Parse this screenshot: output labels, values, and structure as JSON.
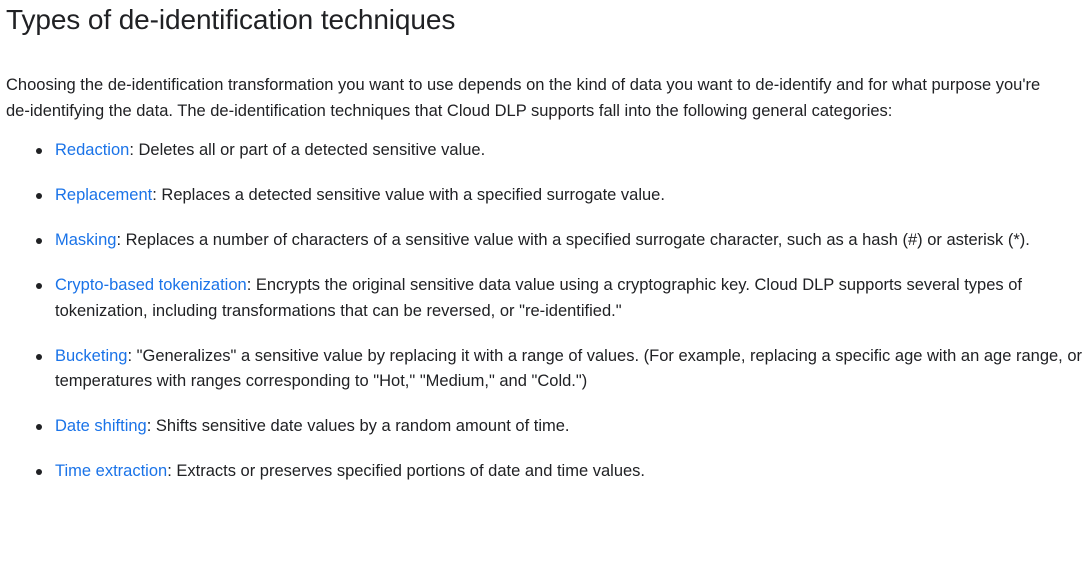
{
  "heading": "Types of de-identification techniques",
  "intro": "Choosing the de-identification transformation you want to use depends on the kind of data you want to de-identify and for what purpose you're de-identifying the data. The de-identification techniques that Cloud DLP supports fall into the following general categories:",
  "techniques": [
    {
      "term": "Redaction",
      "description": ": Deletes all or part of a detected sensitive value."
    },
    {
      "term": "Replacement",
      "description": ": Replaces a detected sensitive value with a specified surrogate value."
    },
    {
      "term": "Masking",
      "description": ": Replaces a number of characters of a sensitive value with a specified surrogate character, such as a hash (#) or asterisk (*)."
    },
    {
      "term": "Crypto-based tokenization",
      "description": ": Encrypts the original sensitive data value using a cryptographic key. Cloud DLP supports several types of tokenization, including transformations that can be reversed, or \"re-identified.\""
    },
    {
      "term": "Bucketing",
      "description": ": \"Generalizes\" a sensitive value by replacing it with a range of values. (For example, replacing a specific age with an age range, or temperatures with ranges corresponding to \"Hot,\" \"Medium,\" and \"Cold.\")"
    },
    {
      "term": "Date shifting",
      "description": ": Shifts sensitive date values by a random amount of time."
    },
    {
      "term": "Time extraction",
      "description": ": Extracts or preserves specified portions of date and time values."
    }
  ],
  "colors": {
    "text": "#202124",
    "link": "#1a73e8",
    "background": "#ffffff"
  }
}
